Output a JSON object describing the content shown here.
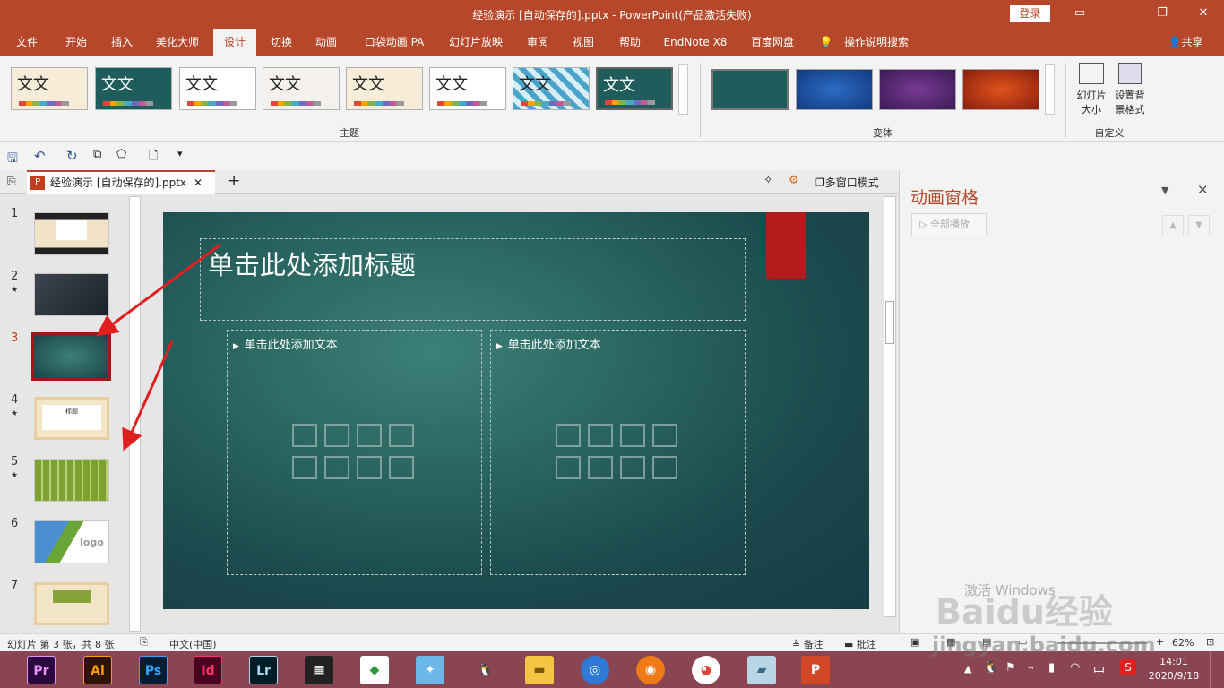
{
  "window": {
    "title": "经验演示 [自动保存的].pptx  -  PowerPoint(产品激活失败)",
    "login": "登录"
  },
  "tabs": [
    "文件",
    "开始",
    "插入",
    "美化大师",
    "设计",
    "切换",
    "动画",
    "口袋动画 PA",
    "幻灯片放映",
    "审阅",
    "视图",
    "帮助",
    "EndNote X8",
    "百度网盘",
    "操作说明搜索"
  ],
  "share": "共享",
  "ribbon": {
    "theme_label": "文文",
    "theme_group": "主题",
    "variant_group": "变体",
    "custom_group": "自定义",
    "slide_size": "幻灯片大小",
    "format_bg": "设置背景格式"
  },
  "doc": {
    "filename": "经验演示 [自动保存的].pptx",
    "multiwindow": "多窗口模式"
  },
  "slides": {
    "numbers": [
      "1",
      "2",
      "3",
      "4",
      "5",
      "6",
      "7"
    ],
    "thumb4_title": "标题",
    "thumb6_logo": "logo"
  },
  "slide": {
    "title_placeholder": "单击此处添加标题",
    "text_placeholder_left": "单击此处添加文本",
    "text_placeholder_right": "单击此处添加文本"
  },
  "anim": {
    "title": "动画窗格",
    "play_all": "全部播放"
  },
  "status": {
    "slide_info": "幻灯片 第 3 张，共 8 张",
    "language": "中文(中国)",
    "notes": "备注",
    "comments": "批注",
    "zoom": "62%"
  },
  "taskbar": {
    "apps": [
      "Pr",
      "Ai",
      "Ps",
      "Id",
      "Lr"
    ],
    "ime": "中",
    "time": "14:01",
    "date": "2020/9/18"
  },
  "watermark": {
    "baidu": "Baidu经验",
    "url": "jingyan.baidu.com",
    "activate": "激活 Windows"
  },
  "colors": {
    "accent": "#b7472a",
    "slide_bg": "#296560",
    "red_tab": "#b21c1c",
    "arrow": "#e02020"
  }
}
